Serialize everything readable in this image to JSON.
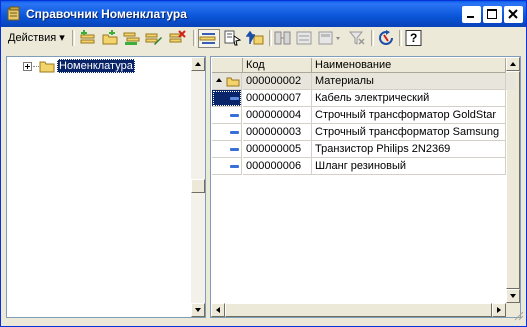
{
  "window": {
    "title": "Справочник Номенклатура"
  },
  "toolbar": {
    "actions_label": "Действия",
    "help_label": "?"
  },
  "tree": {
    "root_label": "Номенклатура"
  },
  "table": {
    "columns": [
      "Код",
      "Наименование"
    ],
    "rows": [
      {
        "code": "000000002",
        "name": "Материалы",
        "kind": "group"
      },
      {
        "code": "000000007",
        "name": "Кабель электрический",
        "kind": "item"
      },
      {
        "code": "000000004",
        "name": "Строчный трансформатор GoldStar",
        "kind": "item"
      },
      {
        "code": "000000003",
        "name": "Строчный трансформатор Samsung",
        "kind": "item"
      },
      {
        "code": "000000005",
        "name": "Транзистор Philips 2N2369",
        "kind": "item"
      },
      {
        "code": "000000006",
        "name": "Шланг резиновый",
        "kind": "item"
      }
    ]
  },
  "colors": {
    "titlebar": "#0a55d8",
    "selection": "#0a246a",
    "window_bg": "#ece9d8"
  }
}
